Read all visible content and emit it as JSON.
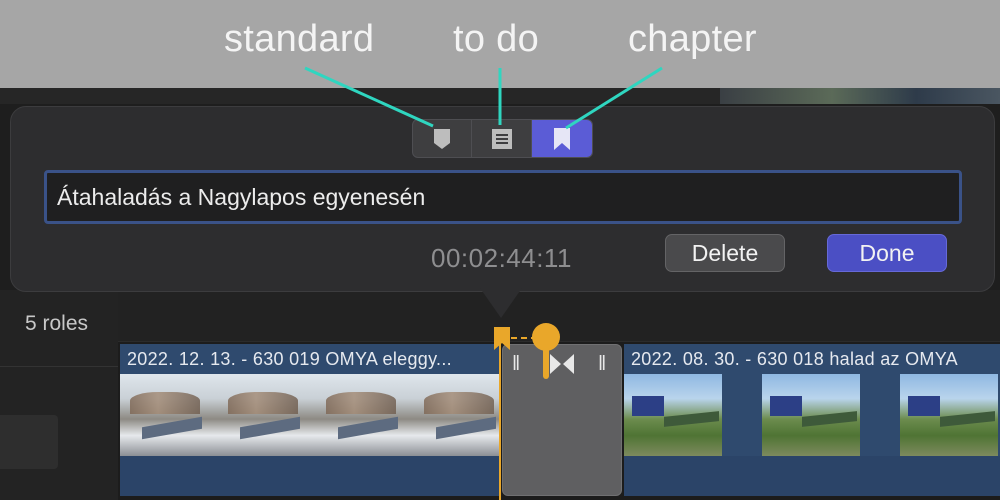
{
  "annotations": {
    "standard": "standard",
    "todo": "to do",
    "chapter": "chapter"
  },
  "marker_popover": {
    "types": [
      {
        "name": "standard",
        "icon": "standard-marker-icon",
        "selected": false
      },
      {
        "name": "to do",
        "icon": "todo-marker-icon",
        "selected": false
      },
      {
        "name": "chapter",
        "icon": "chapter-marker-icon",
        "selected": true
      }
    ],
    "marker_name": "Átahaladás a Nagylapos egyenesén",
    "timecode": "00:02:44:11",
    "delete_label": "Delete",
    "done_label": "Done"
  },
  "sidebar": {
    "roles_label": "5 roles"
  },
  "timeline": {
    "clips": [
      {
        "title": "2022. 12. 13. - 630 019 OMYA eleggy..."
      },
      {
        "title": "2022. 08. 30. - 630 018 halad az OMYA"
      }
    ]
  },
  "colors": {
    "accent": "#5b5cd6",
    "playhead": "#e9a72a",
    "annotation_line": "#2fd6c0",
    "clip": "#2f4a6e"
  }
}
